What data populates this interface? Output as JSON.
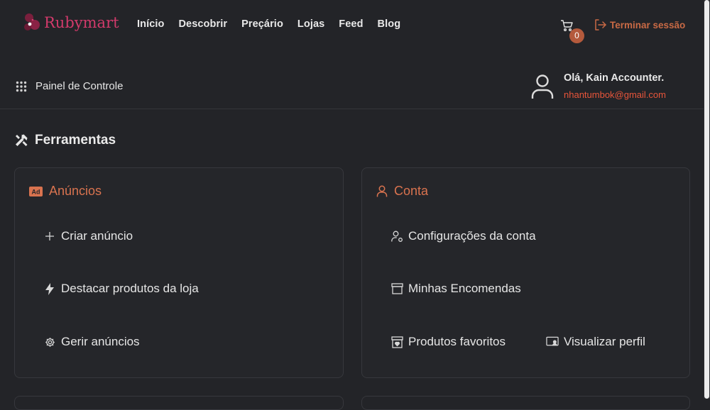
{
  "brand": {
    "name": "Rubymart"
  },
  "nav": {
    "links": [
      "Início",
      "Descobrir",
      "Preçário",
      "Lojas",
      "Feed",
      "Blog"
    ]
  },
  "cart": {
    "count": "0"
  },
  "logout": {
    "label": "Terminar sessão"
  },
  "dashboard": {
    "label": "Painel de Controle"
  },
  "user": {
    "greeting": "Olá, Kain Accounter.",
    "email": "nhantumbok@gmail.com"
  },
  "tools": {
    "title": "Ferramentas"
  },
  "ads_card": {
    "title": "Anúncios",
    "items": [
      "Criar anúncio",
      "Destacar produtos da loja",
      "Gerir anúncios"
    ]
  },
  "account_card": {
    "title": "Conta",
    "items": [
      "Configurações da conta",
      "Minhas Encomendas",
      "Produtos favoritos",
      "Visualizar perfil"
    ]
  },
  "colors": {
    "background": "#232428",
    "accent": "#d9734f",
    "brand": "#d23a6b",
    "email": "#e8553a",
    "badge": "#b45a3c"
  }
}
